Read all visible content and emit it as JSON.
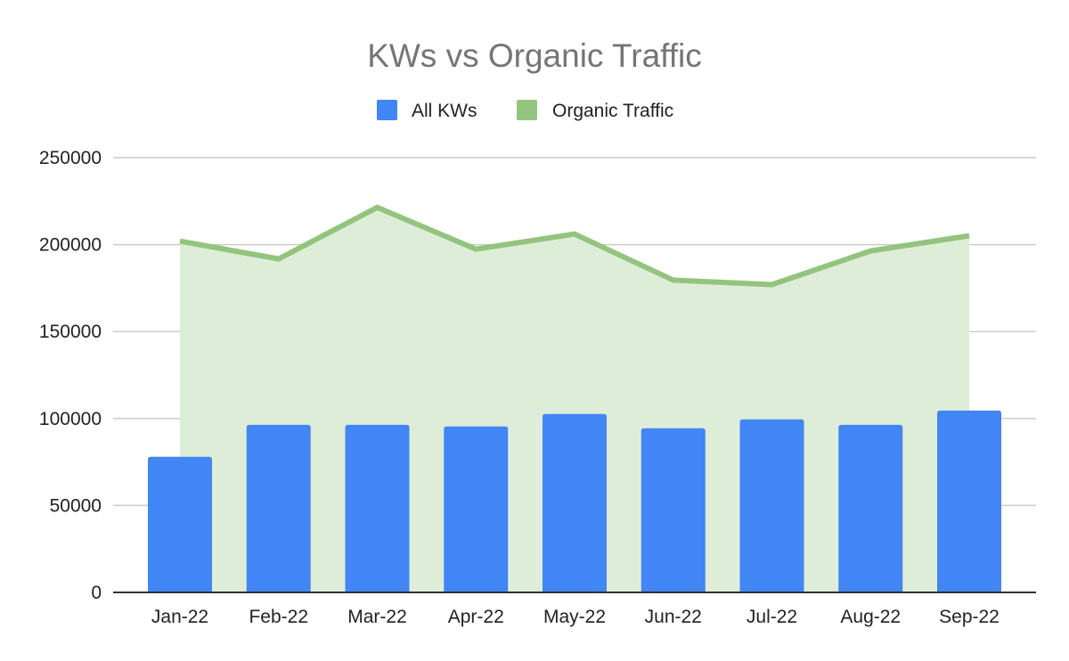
{
  "chart_data": {
    "type": "bar",
    "title": "KWs vs Organic Traffic",
    "xlabel": "",
    "ylabel": "",
    "categories": [
      "Jan-22",
      "Feb-22",
      "Mar-22",
      "Apr-22",
      "May-22",
      "Jun-22",
      "Jul-22",
      "Aug-22",
      "Sep-22"
    ],
    "series": [
      {
        "name": "All KWs",
        "type": "bar",
        "color": "#4285F4",
        "values": [
          78000,
          96400,
          96400,
          95400,
          102600,
          94400,
          99500,
          96400,
          104600
        ]
      },
      {
        "name": "Organic Traffic",
        "type": "area-line",
        "color": "#93C47D",
        "fill_color": "#DEEDD8",
        "values": [
          202000,
          191800,
          221400,
          197400,
          206100,
          179600,
          177000,
          196400,
          205100
        ]
      }
    ],
    "ylim": [
      0,
      250000
    ],
    "yticks": [
      0,
      50000,
      100000,
      150000,
      200000,
      250000
    ],
    "ytick_labels": [
      "0",
      "50000",
      "100000",
      "150000",
      "200000",
      "250000"
    ],
    "grid": true,
    "legend_position": "top-center"
  }
}
